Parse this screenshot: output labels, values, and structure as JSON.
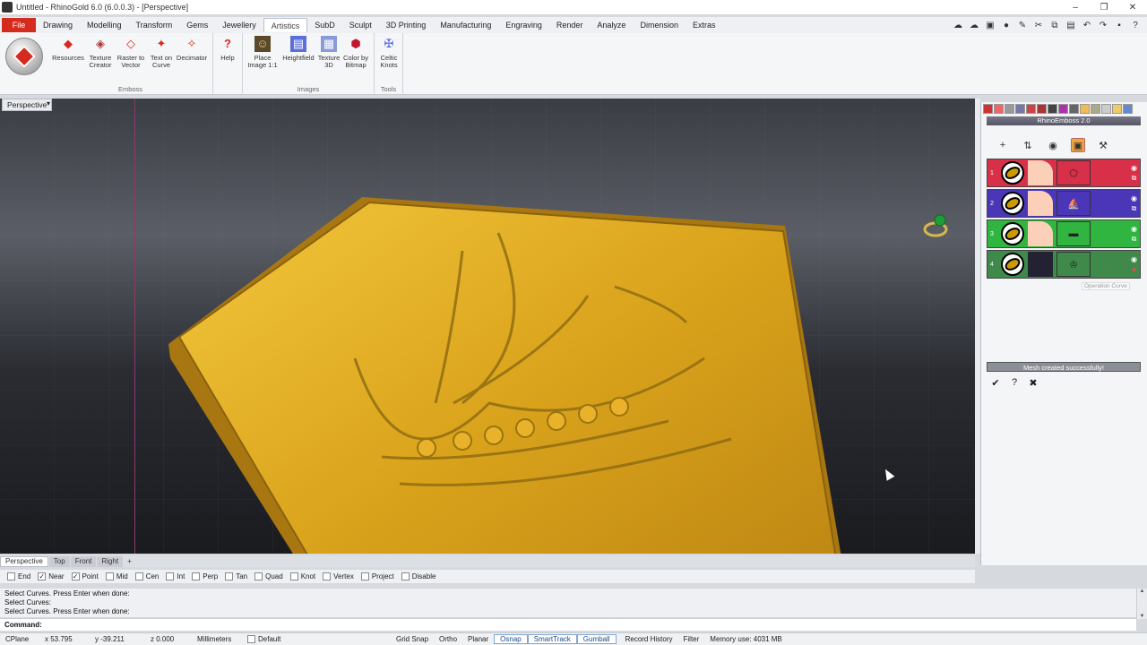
{
  "window": {
    "title": "Untitled - RhinoGold 6.0 (6.0.0.3) - [Perspective]",
    "controls": [
      "–",
      "❐",
      "✕"
    ]
  },
  "menu": {
    "file": "File",
    "items": [
      "Drawing",
      "Modelling",
      "Transform",
      "Gems",
      "Jewellery",
      "Artistics",
      "SubD",
      "Sculpt",
      "3D Printing",
      "Manufacturing",
      "Engraving",
      "Render",
      "Analyze",
      "Dimension",
      "Extras"
    ],
    "active": "Artistics"
  },
  "ribbon": {
    "groups": [
      {
        "label": "Emboss",
        "buttons": [
          "Resources",
          "Texture Creator",
          "Raster to Vector",
          "Text on Curve",
          "Decimator"
        ]
      },
      {
        "label": "",
        "buttons": [
          "Help"
        ]
      },
      {
        "label": "Images",
        "buttons": [
          "Place Image 1:1",
          "Heightfield",
          "Texture 3D",
          "Color by Bitmap"
        ]
      },
      {
        "label": "Tools",
        "buttons": [
          "Celtic Knots"
        ]
      }
    ]
  },
  "viewport": {
    "label": "Perspective",
    "dropdown": "▾"
  },
  "viewport_tabs": [
    "Perspective",
    "Top",
    "Front",
    "Right",
    "+"
  ],
  "osnap": [
    {
      "label": "End",
      "checked": false
    },
    {
      "label": "Near",
      "checked": true
    },
    {
      "label": "Point",
      "checked": true
    },
    {
      "label": "Mid",
      "checked": false
    },
    {
      "label": "Cen",
      "checked": false
    },
    {
      "label": "Int",
      "checked": false
    },
    {
      "label": "Perp",
      "checked": false
    },
    {
      "label": "Tan",
      "checked": false
    },
    {
      "label": "Quad",
      "checked": false
    },
    {
      "label": "Knot",
      "checked": false
    },
    {
      "label": "Vertex",
      "checked": false
    },
    {
      "label": "Project",
      "checked": false
    },
    {
      "label": "Disable",
      "checked": false
    }
  ],
  "history": [
    "Select Curves. Press Enter when done:",
    "Select Curves:",
    "Select Curves. Press Enter when done:"
  ],
  "command": {
    "label": "Command:"
  },
  "status": {
    "cplane": "CPlane",
    "x": "x 53.795",
    "y": "y -39.211",
    "z": "z 0.000",
    "units": "Millimeters",
    "layer": "Default",
    "toggles": [
      {
        "label": "Grid Snap",
        "on": false
      },
      {
        "label": "Ortho",
        "on": false
      },
      {
        "label": "Planar",
        "on": false
      },
      {
        "label": "Osnap",
        "on": true
      },
      {
        "label": "SmartTrack",
        "on": true
      },
      {
        "label": "Gumball",
        "on": true
      },
      {
        "label": "Record History",
        "on": false
      },
      {
        "label": "Filter",
        "on": false
      }
    ],
    "memory": "Memory use: 4031 MB"
  },
  "panel": {
    "title": "RhinoEmboss 2.0",
    "layers": [
      {
        "num": "1",
        "color": "#d9304a",
        "thumb_icon": "⬠"
      },
      {
        "num": "2",
        "color": "#4b36b8",
        "thumb_icon": "⛵"
      },
      {
        "num": "3",
        "color": "#2fb540",
        "thumb_icon": "▬"
      },
      {
        "num": "4",
        "color": "#3f8a4a",
        "thumb_icon": "♔"
      }
    ],
    "tooltip": "Operation Curve",
    "status_message": "Mesh created successfully!"
  }
}
